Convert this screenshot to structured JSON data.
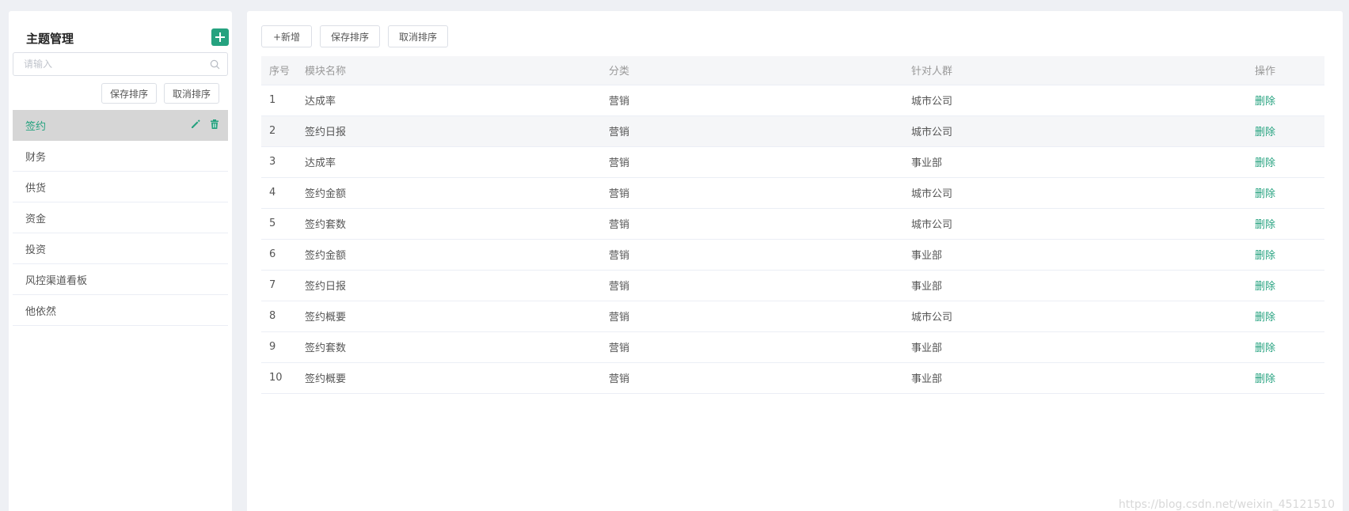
{
  "sidebar": {
    "title": "主题管理",
    "search_placeholder": "请输入",
    "save_sort_label": "保存排序",
    "cancel_sort_label": "取消排序",
    "items": [
      {
        "label": "签约",
        "active": true
      },
      {
        "label": "财务"
      },
      {
        "label": "供货"
      },
      {
        "label": "资金"
      },
      {
        "label": "投资"
      },
      {
        "label": "风控渠道看板"
      },
      {
        "label": "他依然"
      }
    ]
  },
  "toolbar": {
    "add_label": "+新增",
    "save_sort_label": "保存排序",
    "cancel_sort_label": "取消排序"
  },
  "table": {
    "columns": [
      "序号",
      "模块名称",
      "分类",
      "针对人群",
      "操作"
    ],
    "rows": [
      {
        "no": "1",
        "name": "达成率",
        "category": "营销",
        "audience": "城市公司",
        "action": "删除"
      },
      {
        "no": "2",
        "name": "签约日报",
        "category": "营销",
        "audience": "城市公司",
        "action": "删除"
      },
      {
        "no": "3",
        "name": "达成率",
        "category": "营销",
        "audience": "事业部",
        "action": "删除"
      },
      {
        "no": "4",
        "name": "签约金额",
        "category": "营销",
        "audience": "城市公司",
        "action": "删除"
      },
      {
        "no": "5",
        "name": "签约套数",
        "category": "营销",
        "audience": "城市公司",
        "action": "删除"
      },
      {
        "no": "6",
        "name": "签约金额",
        "category": "营销",
        "audience": "事业部",
        "action": "删除"
      },
      {
        "no": "7",
        "name": "签约日报",
        "category": "营销",
        "audience": "事业部",
        "action": "删除"
      },
      {
        "no": "8",
        "name": "签约概要",
        "category": "营销",
        "audience": "城市公司",
        "action": "删除"
      },
      {
        "no": "9",
        "name": "签约套数",
        "category": "营销",
        "audience": "事业部",
        "action": "删除"
      },
      {
        "no": "10",
        "name": "签约概要",
        "category": "营销",
        "audience": "事业部",
        "action": "删除"
      }
    ]
  },
  "watermark": "https://blog.csdn.net/weixin_45121510",
  "colors": {
    "accent": "#25a27f",
    "active_item_bg": "#d6d6d6",
    "header_bg": "#f5f6f8",
    "page_bg": "#eef0f4"
  },
  "icons": {
    "add": "plus-icon",
    "search": "search-icon",
    "edit": "pencil-icon",
    "delete": "trash-icon"
  }
}
